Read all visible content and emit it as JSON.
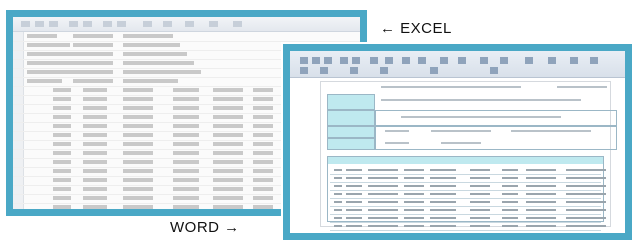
{
  "captions": {
    "excel": "← EXCEL",
    "word": "WORD →"
  },
  "colors": {
    "frame_border": "#4aa8c6",
    "word_highlight": "#bfe9ef"
  },
  "screenshots": {
    "excel": {
      "icon": "excel-spreadsheet-screenshot"
    },
    "word": {
      "icon": "word-document-screenshot"
    }
  }
}
